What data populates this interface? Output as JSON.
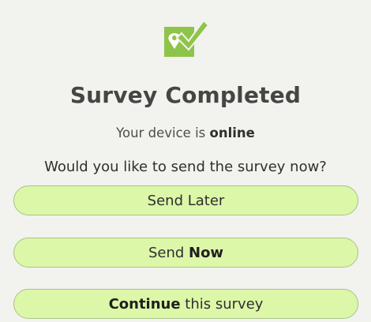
{
  "logo": {
    "icon": "checkbox-location-icon",
    "color": "#8ec449"
  },
  "title": "Survey Completed",
  "status": {
    "prefix": "Your device is ",
    "state": "online"
  },
  "question": "Would you like to send the survey now?",
  "buttons": {
    "send_later": "Send Later",
    "send_now_prefix": "Send ",
    "send_now_emphasis": "Now",
    "continue_emphasis": "Continue",
    "continue_suffix": " this survey"
  }
}
